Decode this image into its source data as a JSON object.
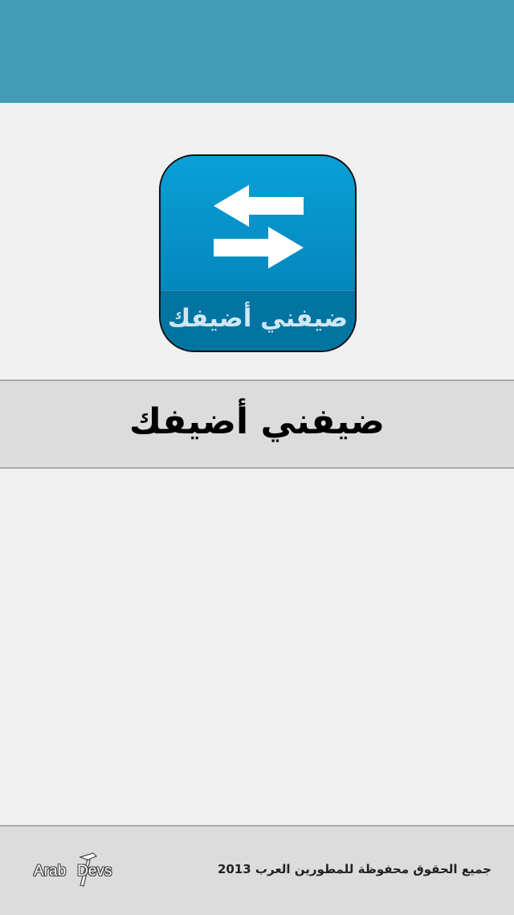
{
  "header": {
    "background_color": "#429cb8"
  },
  "app_icon": {
    "icon": "swap-arrows-icon",
    "label": "ضيفني أضيفك",
    "colors": {
      "upper": "#0aa0d6",
      "lower": "#0174a2",
      "arrows": "#ffffff"
    }
  },
  "title": {
    "text": "ضيفني أضيفك"
  },
  "footer": {
    "copyright": "جميع الحقوق محفوظة للمطورين العرب 2013",
    "logo": {
      "word_left": "Arab",
      "word_right": "Devs",
      "icon": "hammer-icon"
    }
  }
}
